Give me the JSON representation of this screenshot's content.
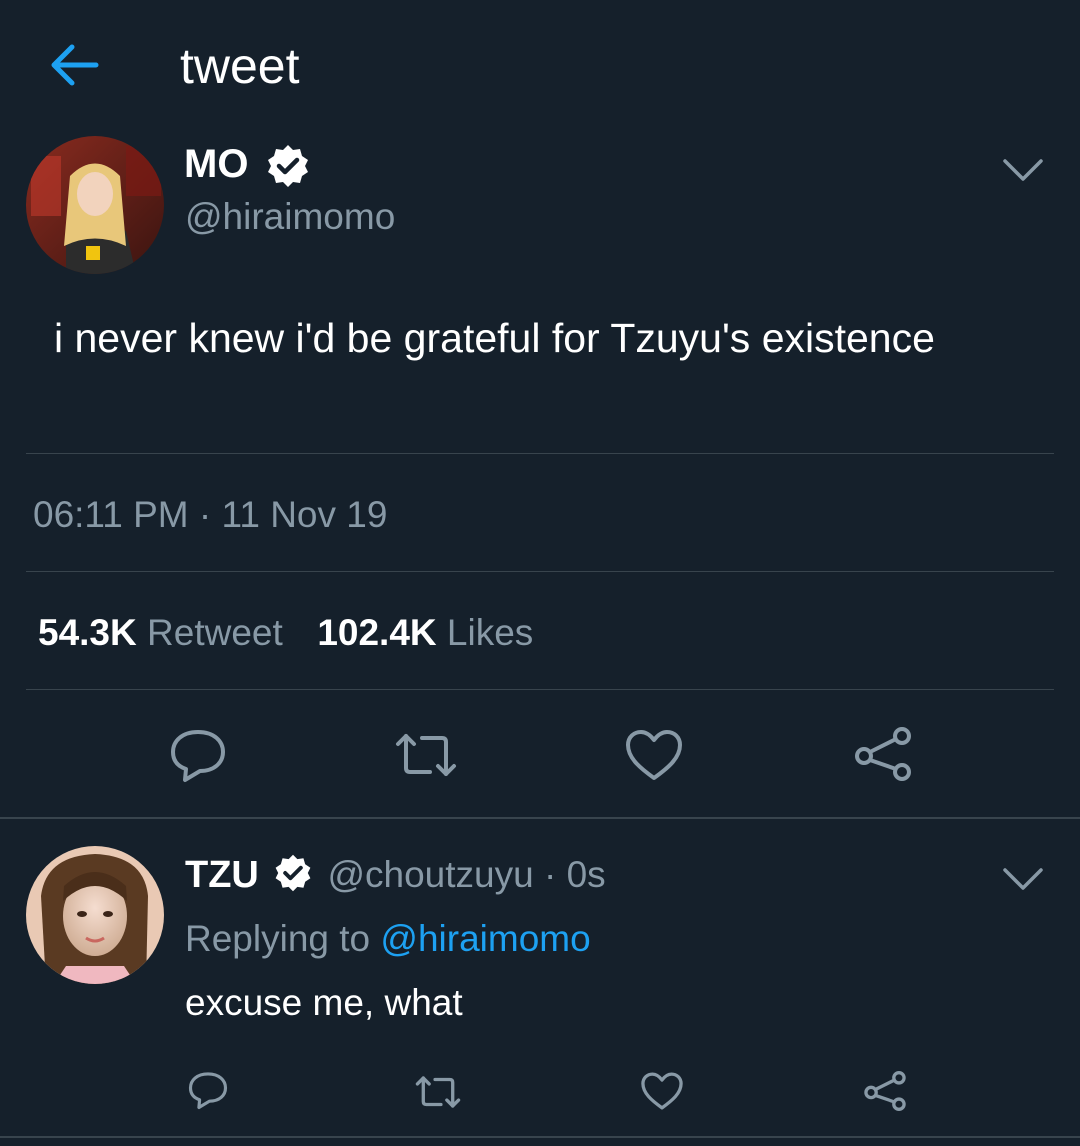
{
  "header": {
    "title": "tweet",
    "back_icon": "arrow-left-icon"
  },
  "main_tweet": {
    "name": "MO",
    "handle": "@hiraimomo",
    "text": "i never knew i'd be grateful for Tzuyu's existence",
    "timestamp": "06:11 PM · 11 Nov 19",
    "retweet_count": "54.3K",
    "retweet_label": "Retweet",
    "likes_count": "102.4K",
    "likes_label": "Likes",
    "verified_icon": "verified-badge-icon",
    "actions": [
      "reply-icon",
      "retweet-icon",
      "like-icon",
      "share-icon"
    ]
  },
  "reply_tweet": {
    "name": "TZU",
    "handle": "@choutzuyu",
    "time": "0s",
    "separator": "·",
    "replying_prefix": "Replying to",
    "replying_to": "@hiraimomo",
    "text": "excuse me, what",
    "actions": [
      "reply-icon",
      "retweet-icon",
      "like-icon",
      "share-icon"
    ]
  },
  "colors": {
    "background": "#15202b",
    "text_primary": "#ffffff",
    "text_secondary": "#8899a6",
    "accent": "#1da1f2",
    "divider": "#38444d"
  }
}
